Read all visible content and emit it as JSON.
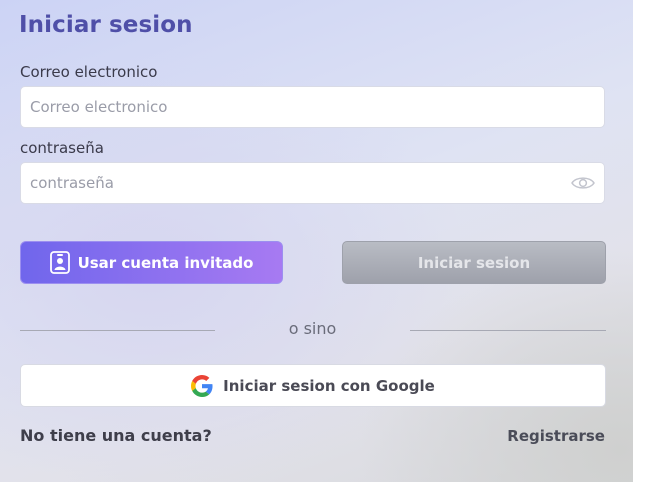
{
  "form": {
    "title": "Iniciar sesion",
    "email_label": "Correo electronico",
    "email_placeholder": "Correo electronico",
    "email_value": "",
    "password_label": "contraseña",
    "password_placeholder": "contraseña",
    "password_value": "",
    "password_toggle_icon": "eye-icon"
  },
  "actions": {
    "guest_label": "Usar cuenta invitado",
    "guest_icon": "badge-icon",
    "login_label": "Iniciar sesion",
    "divider_text": "o sino",
    "google_label": "Iniciar sesion con Google",
    "google_icon": "google-icon"
  },
  "footer": {
    "no_account_text": "No tiene una cuenta?",
    "register_label": "Registrarse"
  },
  "colors": {
    "title": "#4f4fa8",
    "guest_gradient_start": "#7066ec",
    "guest_gradient_end": "#a77af2",
    "login_disabled": "#9ea1ab"
  }
}
